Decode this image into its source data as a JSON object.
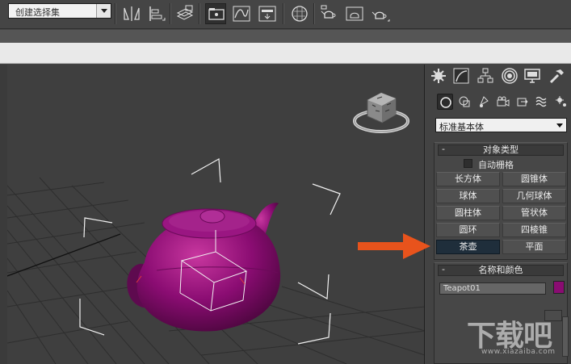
{
  "toolbar": {
    "selection_set": "创建选择集",
    "buttons": [
      "mirror-icon",
      "align-icon",
      "layer-manager-icon",
      "scene-explorer-icon",
      "curve-editor-icon",
      "schematic-view-icon",
      "material-editor-icon",
      "render-setup-icon",
      "render-frame-icon",
      "render-production-icon"
    ]
  },
  "viewport": {
    "object": "teapot",
    "object_color": "#8a0c72",
    "grid": true,
    "viewcube": true
  },
  "command_panel": {
    "tabs": [
      "create-tab-icon",
      "modify-tab-icon",
      "hierarchy-tab-icon",
      "motion-tab-icon",
      "display-tab-icon",
      "utilities-tab-icon"
    ],
    "subcategories": [
      "geometry-icon",
      "shapes-icon",
      "lights-icon",
      "cameras-icon",
      "helpers-icon",
      "space-warps-icon",
      "systems-icon"
    ],
    "category_dropdown": "标准基本体",
    "object_type": {
      "title": "对象类型",
      "minus": "-",
      "autogrid_label": "自动栅格",
      "buttons": [
        "长方体",
        "圆锥体",
        "球体",
        "几何球体",
        "圆柱体",
        "管状体",
        "圆环",
        "四棱锥",
        "茶壶",
        "平面"
      ],
      "selected": "茶壶"
    },
    "name_color": {
      "title": "名称和颜色",
      "minus": "-",
      "name": "Teapot01",
      "color": "#8a0c72"
    }
  },
  "annotation": {
    "arrow_color": "#e8531c"
  },
  "watermark": {
    "big": "下载吧",
    "small": "www.xiazaiba.com"
  }
}
